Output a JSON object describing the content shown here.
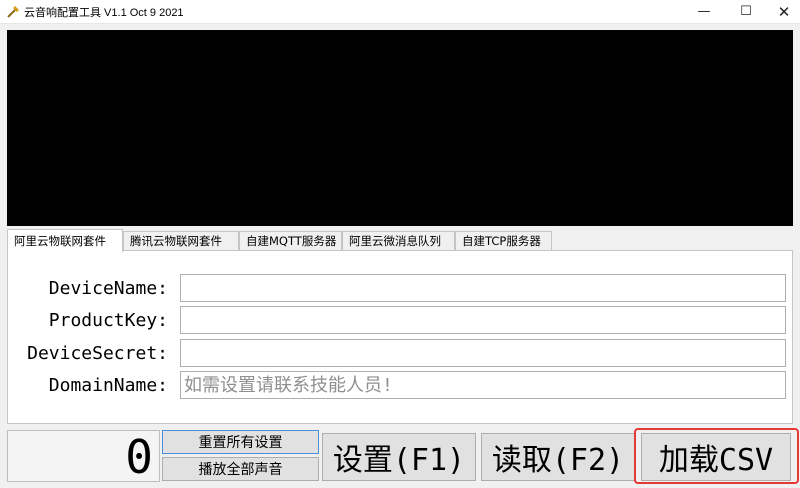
{
  "window": {
    "title": "云音响配置工具 V1.1 Oct  9 2021",
    "minimize_glyph": "—",
    "maximize_glyph": "☐",
    "close_glyph": "✕"
  },
  "tabs": [
    {
      "label": "阿里云物联网套件",
      "active": true
    },
    {
      "label": "腾讯云物联网套件",
      "active": false
    },
    {
      "label": "自建MQTT服务器",
      "active": false
    },
    {
      "label": "阿里云微消息队列",
      "active": false
    },
    {
      "label": "自建TCP服务器",
      "active": false
    }
  ],
  "form": {
    "device_name": {
      "label": "DeviceName:",
      "value": ""
    },
    "product_key": {
      "label": "ProductKey:",
      "value": ""
    },
    "device_secret": {
      "label": "DeviceSecret:",
      "value": ""
    },
    "domain_name": {
      "label": "DomainName:",
      "value": "",
      "placeholder": "如需设置请联系技能人员!"
    }
  },
  "bottom": {
    "counter": "0",
    "reset_all_label": "重置所有设置",
    "play_all_label": "播放全部声音",
    "set_label": "设置(F1)",
    "read_label": "读取(F2)",
    "load_csv_label": "加载CSV"
  },
  "colors": {
    "console_bg": "#000000",
    "highlight": "#e53935"
  }
}
